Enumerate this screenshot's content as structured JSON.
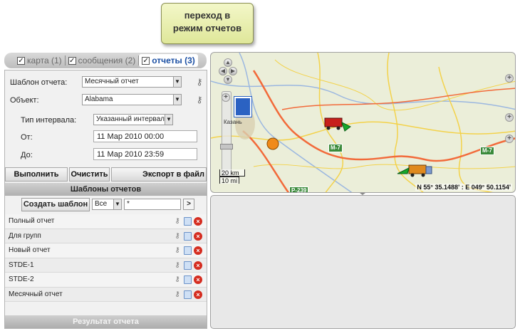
{
  "callout": {
    "line1": "переход в",
    "line2": "режим отчетов"
  },
  "tabs": [
    {
      "label": "карта (1)",
      "checked": true,
      "active": false
    },
    {
      "label": "сообщения (2)",
      "checked": true,
      "active": false
    },
    {
      "label": "отчеты (3)",
      "checked": true,
      "active": true
    }
  ],
  "form": {
    "template_label": "Шаблон отчета:",
    "template_value": "Месячный отчет",
    "object_label": "Объект:",
    "object_value": "Alabama",
    "interval_type_label": "Тип интервала:",
    "interval_type_value": "Указанный интервал",
    "from_label": "От:",
    "from_value": "11 Мар 2010 00:00",
    "to_label": "До:",
    "to_value": "11 Мар 2010 23:59"
  },
  "buttons": {
    "execute": "Выполнить",
    "clear": "Очистить",
    "export": "Экспорт в файл"
  },
  "templates_section": {
    "title": "Шаблоны отчетов",
    "create_button": "Создать шаблон",
    "filter_select": "Все",
    "filter_value": "*",
    "go_button": ">",
    "items": [
      {
        "name": "Полный отчет"
      },
      {
        "name": "Для групп"
      },
      {
        "name": "Новый отчет"
      },
      {
        "name": "STDE-1"
      },
      {
        "name": "STDE-2"
      },
      {
        "name": "Месячный отчет"
      }
    ]
  },
  "result_bar": "Результат отчета",
  "map": {
    "coordinates": "N 55° 35.1488' : E 049° 50.1154'",
    "scale_km": "20 km",
    "scale_mi": "10 mi",
    "road_labels": [
      "M-7",
      "M-7",
      "P-239"
    ],
    "city_label": "Казань",
    "colors": {
      "land": "#ebeed9",
      "major_road": "#f26a3a",
      "minor_road": "#f3d24a",
      "river": "#9bb7e0"
    }
  }
}
